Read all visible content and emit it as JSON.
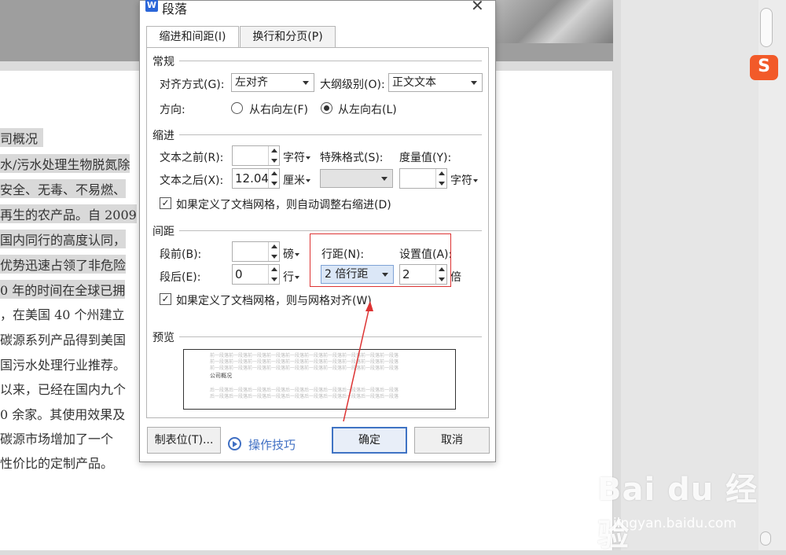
{
  "document": {
    "lines": [
      "司概况",
      "水/污水处理生物脱氮除",
      "安全、无毒、不易燃、",
      "再生的农产品。自 2009",
      "国内同行的高度认同，",
      "优势迅速占领了非危险",
      "0 年的时间在全球已拥",
      "，在美国 40 个州建立",
      "碳源系列产品得到美国",
      "国污水处理行业推荐。",
      "以来，已经在国内九个",
      "0 余家。其使用效果及",
      "碳源市场增加了一个",
      "性价比的定制产品。"
    ]
  },
  "watermark": {
    "text": "Bai  du 经验",
    "url": "jingyan.baidu.com"
  },
  "sogou": {
    "icon_text": "S"
  },
  "dialog": {
    "title": "段落",
    "app_icon": "W",
    "close_glyph": "✕",
    "tabs": [
      "缩进和间距(I)",
      "换行和分页(P)"
    ],
    "general": {
      "title": "常规",
      "align_label": "对齐方式(G):",
      "align_value": "左对齐",
      "outline_label": "大纲级别(O):",
      "outline_value": "正文文本",
      "direction_label": "方向:",
      "rtl_label": "从右向左(F)",
      "ltr_label": "从左向右(L)",
      "direction_selected": "ltr"
    },
    "indent": {
      "title": "缩进",
      "before_label": "文本之前(R):",
      "before_value": "",
      "before_unit": "字符",
      "after_label": "文本之后(X):",
      "after_value": "12.04",
      "after_unit": "厘米",
      "special_label": "特殊格式(S):",
      "special_value": "",
      "measure_label": "度量值(Y):",
      "measure_value": "",
      "measure_unit": "字符",
      "auto_adjust_label": "如果定义了文档网格，则自动调整右缩进(D)",
      "auto_adjust_checked": true
    },
    "spacing": {
      "title": "间距",
      "before_label": "段前(B):",
      "before_value": "",
      "before_unit": "磅",
      "after_label": "段后(E):",
      "after_value": "0",
      "after_unit": "行",
      "line_label": "行距(N):",
      "line_value": "2 倍行距",
      "set_label": "设置值(A):",
      "set_value": "2",
      "set_unit": "倍",
      "grid_label": "如果定义了文档网格，则与网格对齐(W)",
      "grid_checked": true
    },
    "preview": {
      "title": "预览",
      "placeholder": "前一段落前一段落前一段落前一段落前一段落前一段落前一段落前一段落前一段落前一段落",
      "sample": "公司概况",
      "next_placeholder": "后一段落后一段落后一段落后一段落后一段落后一段落后一段落后一段落后一段落后一段落"
    },
    "buttons": {
      "tabstops": "制表位(T)...",
      "tips": "操作技巧",
      "ok": "确定",
      "cancel": "取消"
    },
    "check_glyph": "✓"
  }
}
